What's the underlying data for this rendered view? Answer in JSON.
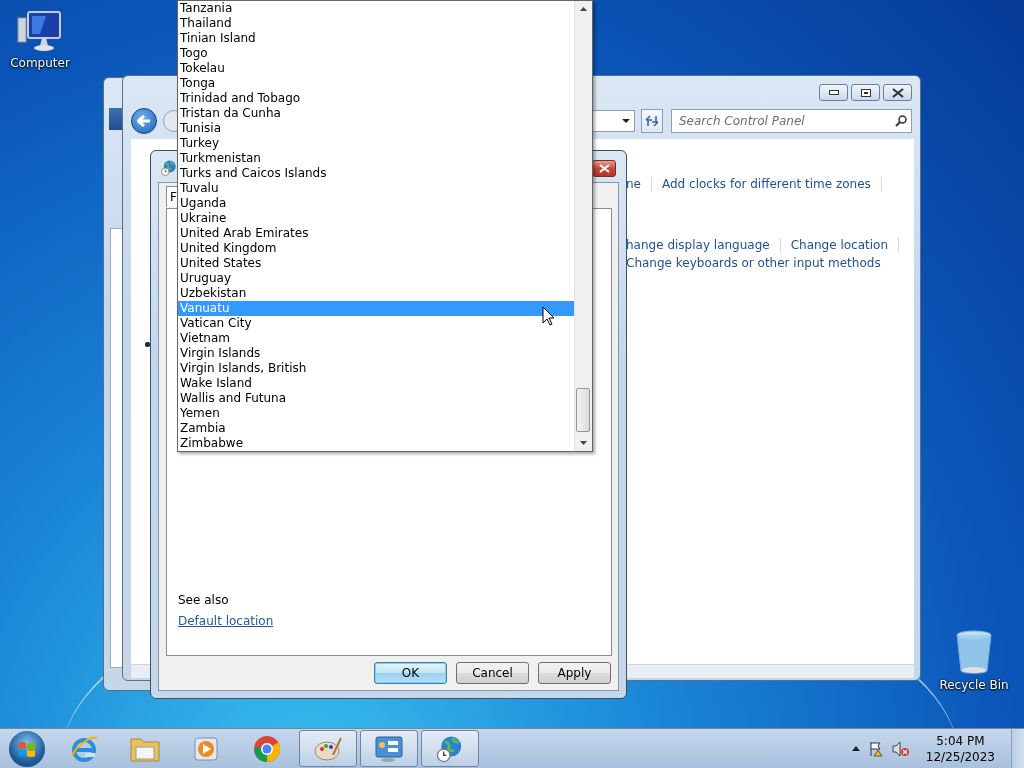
{
  "desktop_icons": [
    {
      "kind": "computer",
      "label": "Computer"
    },
    {
      "kind": "recycle",
      "label": "Recycle Bin"
    }
  ],
  "control_panel": {
    "search": {
      "placeholder": "Search Control Panel"
    },
    "link_groups": [
      [
        "ne",
        "Add clocks for different time zones"
      ],
      [
        "hange display language",
        "Change location",
        "Change keyboards or other input methods"
      ]
    ]
  },
  "region_dialog": {
    "tabs": [
      {
        "label": "F",
        "selected": true
      }
    ],
    "see_also": "See also",
    "links": [
      "Default location"
    ],
    "buttons": [
      {
        "label": "OK",
        "default": true
      },
      {
        "label": "Cancel",
        "default": false
      },
      {
        "label": "Apply",
        "default": false
      }
    ]
  },
  "country_list": {
    "items": [
      {
        "label": "Tanzania",
        "selected": false
      },
      {
        "label": "Thailand",
        "selected": false
      },
      {
        "label": "Tinian Island",
        "selected": false
      },
      {
        "label": "Togo",
        "selected": false
      },
      {
        "label": "Tokelau",
        "selected": false
      },
      {
        "label": "Tonga",
        "selected": false
      },
      {
        "label": "Trinidad and Tobago",
        "selected": false
      },
      {
        "label": "Tristan da Cunha",
        "selected": false
      },
      {
        "label": "Tunisia",
        "selected": false
      },
      {
        "label": "Turkey",
        "selected": false
      },
      {
        "label": "Turkmenistan",
        "selected": false
      },
      {
        "label": "Turks and Caicos Islands",
        "selected": false
      },
      {
        "label": "Tuvalu",
        "selected": false
      },
      {
        "label": "Uganda",
        "selected": false
      },
      {
        "label": "Ukraine",
        "selected": false
      },
      {
        "label": "United Arab Emirates",
        "selected": false
      },
      {
        "label": "United Kingdom",
        "selected": false
      },
      {
        "label": "United States",
        "selected": false
      },
      {
        "label": "Uruguay",
        "selected": false
      },
      {
        "label": "Uzbekistan",
        "selected": false
      },
      {
        "label": "Vanuatu",
        "selected": true
      },
      {
        "label": "Vatican City",
        "selected": false
      },
      {
        "label": "Vietnam",
        "selected": false
      },
      {
        "label": "Virgin Islands",
        "selected": false
      },
      {
        "label": "Virgin Islands, British",
        "selected": false
      },
      {
        "label": "Wake Island",
        "selected": false
      },
      {
        "label": "Wallis and Futuna",
        "selected": false
      },
      {
        "label": "Yemen",
        "selected": false
      },
      {
        "label": "Zambia",
        "selected": false
      },
      {
        "label": "Zimbabwe",
        "selected": false
      }
    ]
  },
  "taskbar": {
    "apps": [
      {
        "kind": "ie",
        "running": false
      },
      {
        "kind": "explorer",
        "running": false
      },
      {
        "kind": "media",
        "running": false
      },
      {
        "kind": "chrome",
        "running": false
      },
      {
        "kind": "paint",
        "running": true
      },
      {
        "kind": "control",
        "running": true
      },
      {
        "kind": "region",
        "running": true
      }
    ],
    "clock": {
      "time": "5:04 PM",
      "date": "12/25/2023"
    }
  }
}
